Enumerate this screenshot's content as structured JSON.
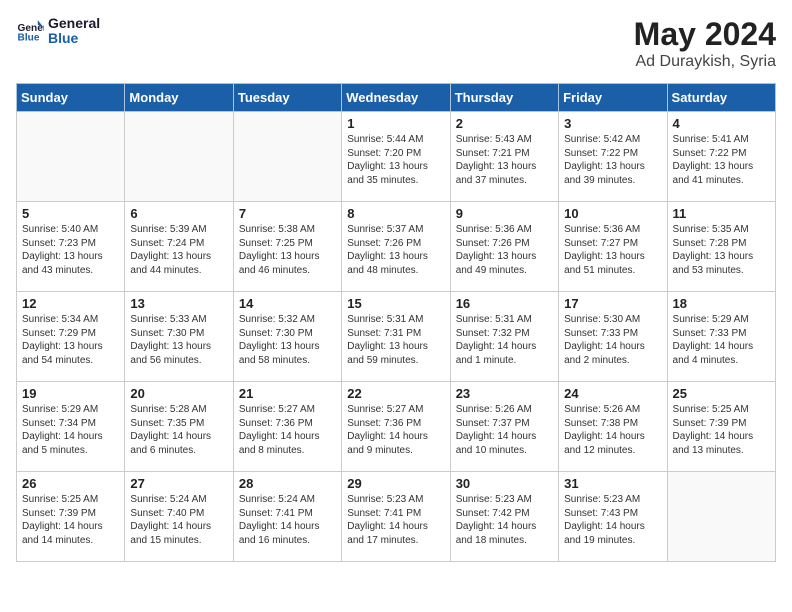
{
  "header": {
    "logo_line1": "General",
    "logo_line2": "Blue",
    "month_year": "May 2024",
    "location": "Ad Duraykish, Syria"
  },
  "days_of_week": [
    "Sunday",
    "Monday",
    "Tuesday",
    "Wednesday",
    "Thursday",
    "Friday",
    "Saturday"
  ],
  "weeks": [
    [
      {
        "day": "",
        "info": ""
      },
      {
        "day": "",
        "info": ""
      },
      {
        "day": "",
        "info": ""
      },
      {
        "day": "1",
        "info": "Sunrise: 5:44 AM\nSunset: 7:20 PM\nDaylight: 13 hours\nand 35 minutes."
      },
      {
        "day": "2",
        "info": "Sunrise: 5:43 AM\nSunset: 7:21 PM\nDaylight: 13 hours\nand 37 minutes."
      },
      {
        "day": "3",
        "info": "Sunrise: 5:42 AM\nSunset: 7:22 PM\nDaylight: 13 hours\nand 39 minutes."
      },
      {
        "day": "4",
        "info": "Sunrise: 5:41 AM\nSunset: 7:22 PM\nDaylight: 13 hours\nand 41 minutes."
      }
    ],
    [
      {
        "day": "5",
        "info": "Sunrise: 5:40 AM\nSunset: 7:23 PM\nDaylight: 13 hours\nand 43 minutes."
      },
      {
        "day": "6",
        "info": "Sunrise: 5:39 AM\nSunset: 7:24 PM\nDaylight: 13 hours\nand 44 minutes."
      },
      {
        "day": "7",
        "info": "Sunrise: 5:38 AM\nSunset: 7:25 PM\nDaylight: 13 hours\nand 46 minutes."
      },
      {
        "day": "8",
        "info": "Sunrise: 5:37 AM\nSunset: 7:26 PM\nDaylight: 13 hours\nand 48 minutes."
      },
      {
        "day": "9",
        "info": "Sunrise: 5:36 AM\nSunset: 7:26 PM\nDaylight: 13 hours\nand 49 minutes."
      },
      {
        "day": "10",
        "info": "Sunrise: 5:36 AM\nSunset: 7:27 PM\nDaylight: 13 hours\nand 51 minutes."
      },
      {
        "day": "11",
        "info": "Sunrise: 5:35 AM\nSunset: 7:28 PM\nDaylight: 13 hours\nand 53 minutes."
      }
    ],
    [
      {
        "day": "12",
        "info": "Sunrise: 5:34 AM\nSunset: 7:29 PM\nDaylight: 13 hours\nand 54 minutes."
      },
      {
        "day": "13",
        "info": "Sunrise: 5:33 AM\nSunset: 7:30 PM\nDaylight: 13 hours\nand 56 minutes."
      },
      {
        "day": "14",
        "info": "Sunrise: 5:32 AM\nSunset: 7:30 PM\nDaylight: 13 hours\nand 58 minutes."
      },
      {
        "day": "15",
        "info": "Sunrise: 5:31 AM\nSunset: 7:31 PM\nDaylight: 13 hours\nand 59 minutes."
      },
      {
        "day": "16",
        "info": "Sunrise: 5:31 AM\nSunset: 7:32 PM\nDaylight: 14 hours\nand 1 minute."
      },
      {
        "day": "17",
        "info": "Sunrise: 5:30 AM\nSunset: 7:33 PM\nDaylight: 14 hours\nand 2 minutes."
      },
      {
        "day": "18",
        "info": "Sunrise: 5:29 AM\nSunset: 7:33 PM\nDaylight: 14 hours\nand 4 minutes."
      }
    ],
    [
      {
        "day": "19",
        "info": "Sunrise: 5:29 AM\nSunset: 7:34 PM\nDaylight: 14 hours\nand 5 minutes."
      },
      {
        "day": "20",
        "info": "Sunrise: 5:28 AM\nSunset: 7:35 PM\nDaylight: 14 hours\nand 6 minutes."
      },
      {
        "day": "21",
        "info": "Sunrise: 5:27 AM\nSunset: 7:36 PM\nDaylight: 14 hours\nand 8 minutes."
      },
      {
        "day": "22",
        "info": "Sunrise: 5:27 AM\nSunset: 7:36 PM\nDaylight: 14 hours\nand 9 minutes."
      },
      {
        "day": "23",
        "info": "Sunrise: 5:26 AM\nSunset: 7:37 PM\nDaylight: 14 hours\nand 10 minutes."
      },
      {
        "day": "24",
        "info": "Sunrise: 5:26 AM\nSunset: 7:38 PM\nDaylight: 14 hours\nand 12 minutes."
      },
      {
        "day": "25",
        "info": "Sunrise: 5:25 AM\nSunset: 7:39 PM\nDaylight: 14 hours\nand 13 minutes."
      }
    ],
    [
      {
        "day": "26",
        "info": "Sunrise: 5:25 AM\nSunset: 7:39 PM\nDaylight: 14 hours\nand 14 minutes."
      },
      {
        "day": "27",
        "info": "Sunrise: 5:24 AM\nSunset: 7:40 PM\nDaylight: 14 hours\nand 15 minutes."
      },
      {
        "day": "28",
        "info": "Sunrise: 5:24 AM\nSunset: 7:41 PM\nDaylight: 14 hours\nand 16 minutes."
      },
      {
        "day": "29",
        "info": "Sunrise: 5:23 AM\nSunset: 7:41 PM\nDaylight: 14 hours\nand 17 minutes."
      },
      {
        "day": "30",
        "info": "Sunrise: 5:23 AM\nSunset: 7:42 PM\nDaylight: 14 hours\nand 18 minutes."
      },
      {
        "day": "31",
        "info": "Sunrise: 5:23 AM\nSunset: 7:43 PM\nDaylight: 14 hours\nand 19 minutes."
      },
      {
        "day": "",
        "info": ""
      }
    ]
  ]
}
